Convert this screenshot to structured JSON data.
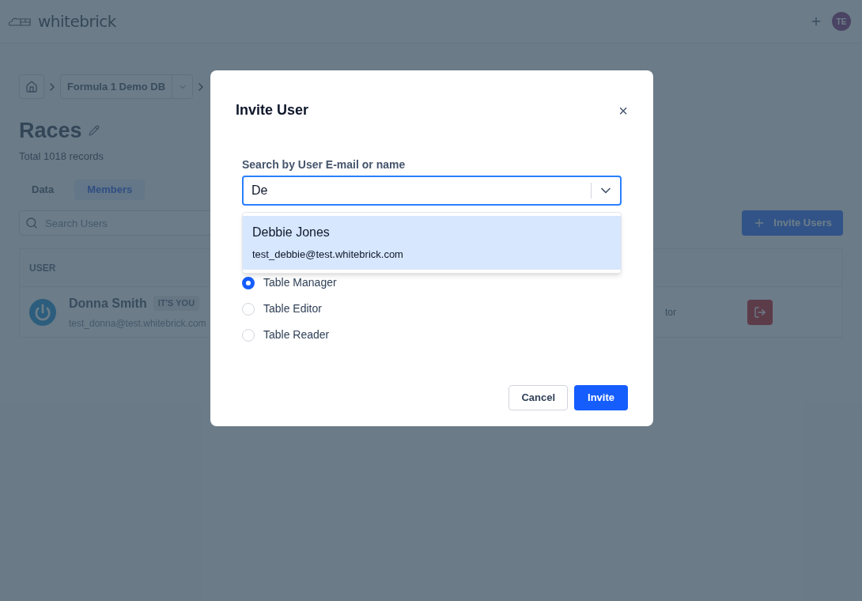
{
  "header": {
    "logo": "whitebrick",
    "avatar": "TE"
  },
  "breadcrumb": {
    "database": "Formula 1 Demo DB"
  },
  "page": {
    "title": "Races",
    "subtitle": "Total 1018 records"
  },
  "tabs": [
    {
      "label": "Data",
      "selected": false
    },
    {
      "label": "Members",
      "selected": true
    }
  ],
  "search": {
    "placeholder": "Search Users"
  },
  "invite_button": "Invite Users",
  "table": {
    "columns": [
      "USER"
    ],
    "rows": [
      {
        "name": "Donna Smith",
        "badge": "IT'S YOU",
        "email": "test_donna@test.whitebrick.com",
        "role": "tor"
      }
    ]
  },
  "dialog": {
    "title": "Invite User",
    "close": "×",
    "field_label": "Search by User E-mail or name",
    "value": "De",
    "suggestions": [
      {
        "name": "Debbie Jones",
        "email": "test_debbie@test.whitebrick.com",
        "selected": true
      }
    ],
    "roles": [
      {
        "label": "Table Manager",
        "selected": true
      },
      {
        "label": "Table Editor",
        "selected": false
      },
      {
        "label": "Table Reader",
        "selected": false
      }
    ],
    "cancel": "Cancel",
    "submit": "Invite"
  }
}
